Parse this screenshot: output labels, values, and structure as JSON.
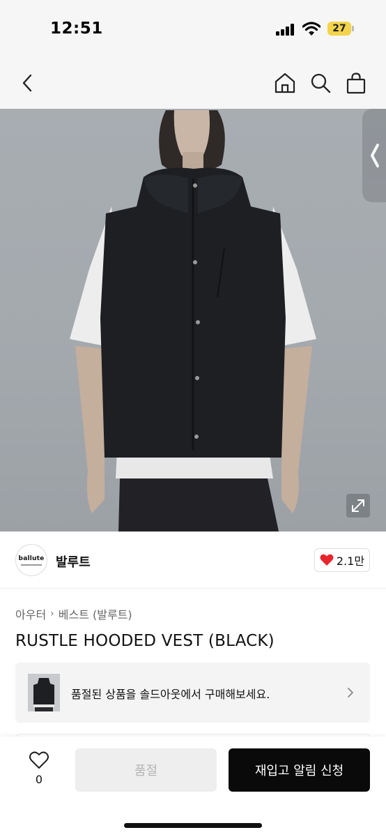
{
  "status_bar": {
    "time": "12:51",
    "battery": "27"
  },
  "brand": {
    "logo_text": "ballute",
    "name": "발루트",
    "likes": "2.1만"
  },
  "breadcrumb": {
    "category": "아우터",
    "subcategory": "베스트 (발루트)"
  },
  "product": {
    "title": "RUSTLE HOODED VEST (BLACK)"
  },
  "banner": {
    "text": "품절된 상품을 솔드아웃에서 구매해보세요."
  },
  "bottom_bar": {
    "wish_count": "0",
    "soldout_label": "품절",
    "restock_label": "재입고 알림 신청"
  },
  "colors": {
    "accent_red": "#e8242c",
    "primary_black": "#0a0a0a",
    "battery_yellow": "#f3d44b"
  }
}
